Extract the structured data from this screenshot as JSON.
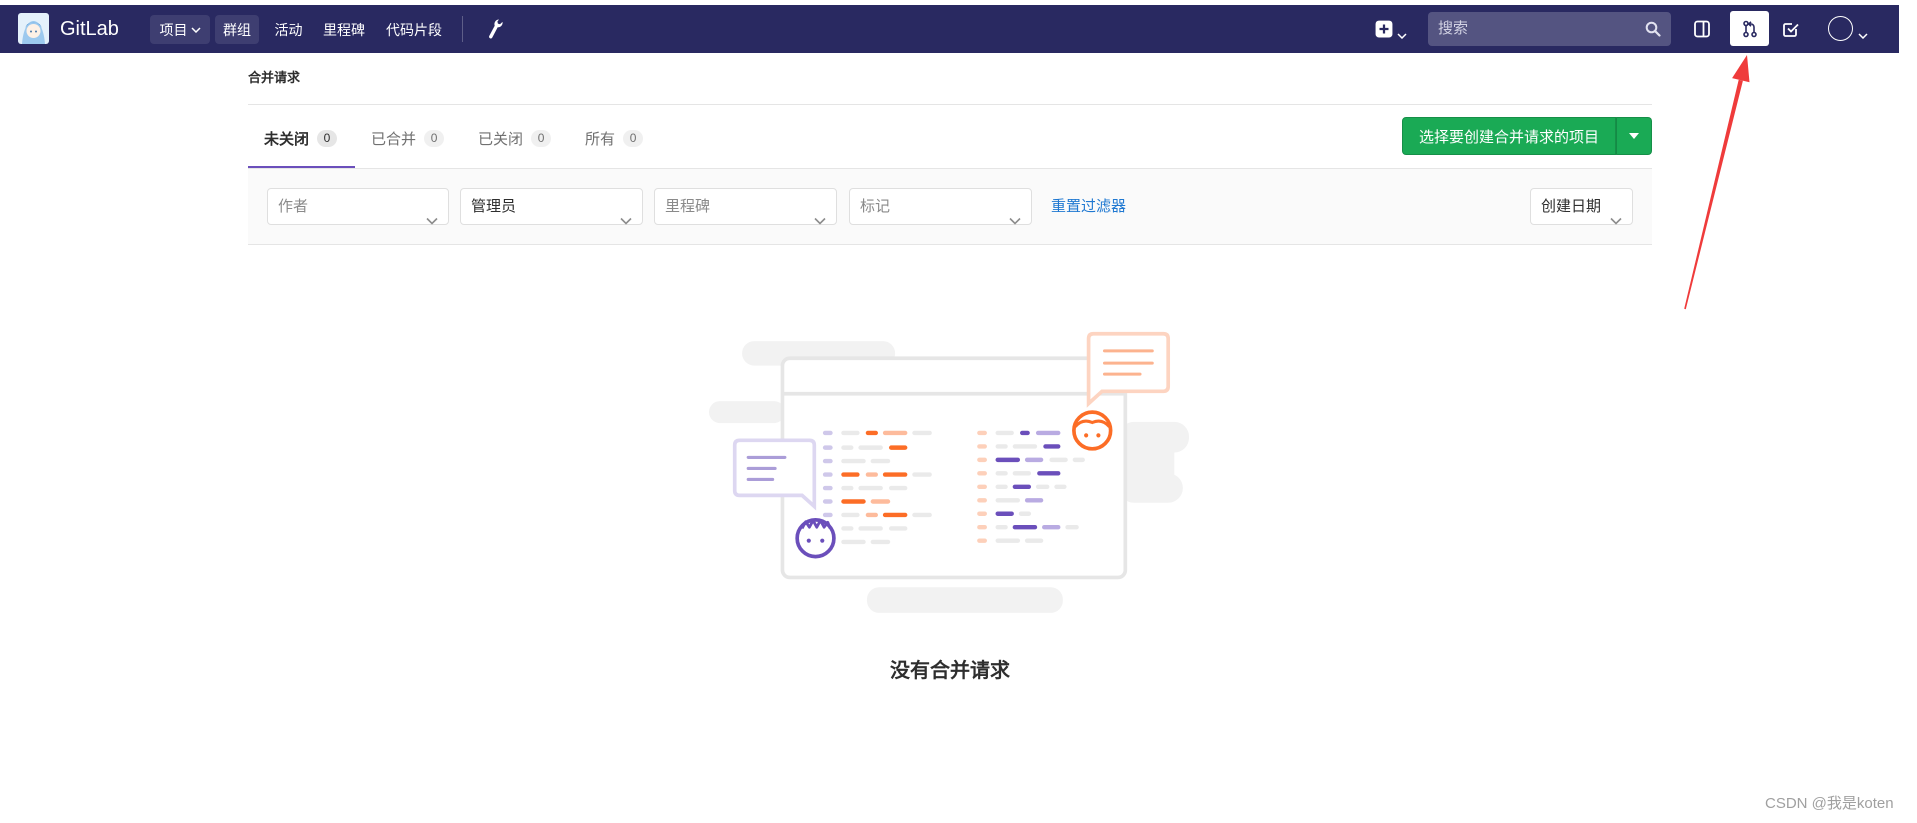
{
  "navbar": {
    "brand": "GitLab",
    "logo": "gitlab-user-logo-icon",
    "menu": [
      {
        "label": "项目",
        "icon": "chevron-down-icon"
      },
      {
        "label": "群组"
      },
      {
        "label": "活动"
      },
      {
        "label": "里程碑"
      },
      {
        "label": "代码片段"
      }
    ],
    "admin_icon": "wrench-icon",
    "new_menu_icon": "plus-square-icon",
    "search": {
      "placeholder": "搜索",
      "icon": "search-icon"
    },
    "shortcut_icons": [
      "issues-icon",
      "merge-request-icon",
      "todo-icon"
    ],
    "avatar_icon": "user-avatar-icon"
  },
  "breadcrumb": {
    "current": "合并请求"
  },
  "tabs": [
    {
      "label": "未关闭",
      "count": 0,
      "active": true
    },
    {
      "label": "已合并",
      "count": 0,
      "active": false
    },
    {
      "label": "已关闭",
      "count": 0,
      "active": false
    },
    {
      "label": "所有",
      "count": 0,
      "active": false
    }
  ],
  "new_merge_request_button": {
    "label": "选择要创建合并请求的项目",
    "dropdown_icon": "caret-down-icon"
  },
  "filters": {
    "dropdowns": [
      {
        "label": "作者"
      },
      {
        "label": "管理员"
      },
      {
        "label": "里程碑"
      },
      {
        "label": "标记"
      }
    ],
    "reset_label": "重置过滤器",
    "sort": {
      "label": "创建日期",
      "icon": "chevron-down-icon"
    }
  },
  "empty_state": {
    "illustration": "merge-requests-empty-illustration",
    "title": "没有合并请求"
  },
  "watermark": "CSDN @我是koten",
  "colors": {
    "navbar": "#292961",
    "search_bg": "#545481",
    "primary_button": "#1aaa55",
    "link": "#1f78d1",
    "active_tab_underline": "#6b4fbb",
    "illustration_orange": "#fc6d26",
    "illustration_purple": "#6b4fbb",
    "annotation_arrow": "#ef3b3b"
  }
}
